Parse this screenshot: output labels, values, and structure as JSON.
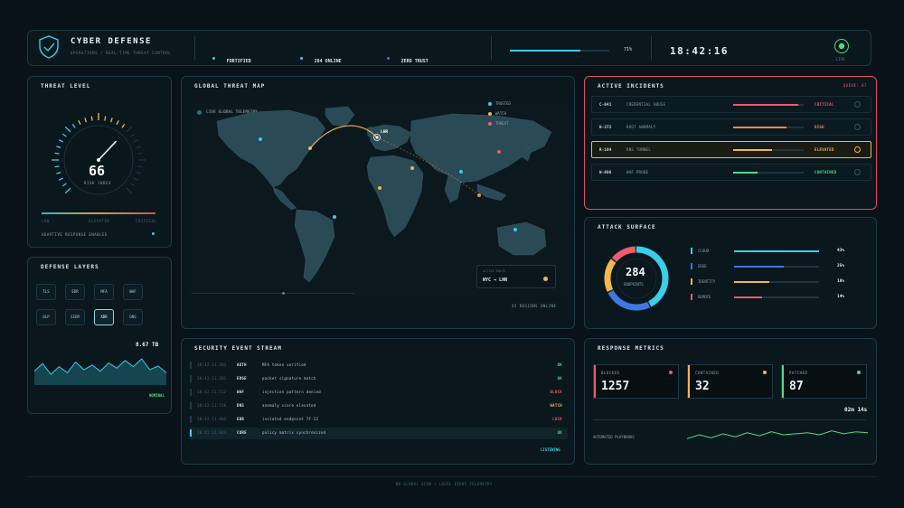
{
  "colors": {
    "bg": "#081218",
    "cyan": "#38d0e8",
    "green": "#4fdc8a",
    "red": "#ef5a6f",
    "orange": "#f08a4b",
    "yellow": "#f2b84b",
    "blue": "#3f78e0"
  },
  "header": {
    "brand_icon": "shield-check-icon",
    "title": "CYBER DEFENSE",
    "subtitle": "OPERATIONS / REAL-TIME THREAT CONTROL",
    "status_items": [
      {
        "value": "FORTIFIED",
        "dot_color": "#4fdc8a"
      },
      {
        "value": "284 ONLINE",
        "dot_color": "#38d0e8"
      },
      {
        "value": "ZERO TRUST",
        "dot_color": "#3f78e0"
      }
    ],
    "load": {
      "value_text": "71%",
      "fraction": 0.71
    },
    "clock": "18:42:16",
    "live_label": "LIVE"
  },
  "threat_level": {
    "title": "THREAT LEVEL",
    "value": "66",
    "gauge_fraction": 0.66,
    "label": "RISK INDEX",
    "scale_labels": [
      "LOW",
      "ELEVATED",
      "CRITICAL"
    ],
    "footer": "ADAPTIVE RESPONSE ENABLED"
  },
  "global_map": {
    "title": "GLOBAL THREAT MAP",
    "live_label": "LIVE GLOBAL TELEMETRY",
    "hub_label": "LHR",
    "legend": [
      {
        "label": "TRUSTED",
        "color": "#38d0e8"
      },
      {
        "label": "WATCH",
        "color": "#f2b84b"
      },
      {
        "label": "THREAT",
        "color": "#ef5a6f"
      }
    ],
    "route_box_title": "ACTIVE ROUTE",
    "route": "NYC → LHR",
    "regions_online": "42 REGIONS ONLINE"
  },
  "active_incidents": {
    "title": "ACTIVE INCIDENTS",
    "tag": "QUEUE: 07",
    "items": [
      {
        "id": "C-041",
        "name": "CREDENTIAL ABUSE",
        "status": "CRITICAL",
        "color": "#ef5a6f",
        "fill": 0.92,
        "highlight": false
      },
      {
        "id": "H-372",
        "name": "ROOT ANOMALY",
        "status": "HIGH",
        "color": "#f08a4b",
        "fill": 0.76,
        "highlight": false
      },
      {
        "id": "R-104",
        "name": "DNS TUNNEL",
        "status": "ELEVATED",
        "color": "#f2b84b",
        "fill": 0.55,
        "highlight": true
      },
      {
        "id": "W-806",
        "name": "WAF PROBE",
        "status": "CONTAINED",
        "color": "#4fdc8a",
        "fill": 0.35,
        "highlight": false
      }
    ]
  },
  "defense_layers": {
    "title": "DEFENSE LAYERS",
    "chips": [
      "TLS",
      "EDR",
      "MFA",
      "WAF",
      "DLP",
      "SIEM",
      "XDR",
      "DNS"
    ],
    "active_chip": "XDR",
    "throughput_value": "8.67 TB",
    "status": "NOMINAL",
    "sparkline": [
      0.45,
      0.7,
      0.35,
      0.6,
      0.4,
      0.75,
      0.5,
      0.65,
      0.45,
      0.72,
      0.55,
      0.8,
      0.6,
      0.85,
      0.5,
      0.62,
      0.4
    ]
  },
  "attack_surface": {
    "title": "ATTACK SURFACE",
    "total": "284",
    "total_label": "ENDPOINTS",
    "segments": [
      {
        "label": "CLOUD",
        "value": "43%",
        "fraction": 0.43,
        "color": "#38d0e8"
      },
      {
        "label": "EDGE",
        "value": "25%",
        "fraction": 0.25,
        "color": "#3f78e0"
      },
      {
        "label": "IDENTITY",
        "value": "18%",
        "fraction": 0.18,
        "color": "#f2b84b"
      },
      {
        "label": "REMOTE",
        "value": "14%",
        "fraction": 0.14,
        "color": "#ef5a6f"
      }
    ]
  },
  "event_stream": {
    "title": "SECURITY EVENT STREAM",
    "events": [
      {
        "time": "18:42:11.203",
        "source": "AUTH",
        "message": "MFA token verified",
        "status": "OK",
        "color": "#4fdc8a"
      },
      {
        "time": "18:42:11.381",
        "source": "EDGE",
        "message": "packet signature match",
        "status": "OK",
        "color": "#4fdc8a"
      },
      {
        "time": "18:42:11.512",
        "source": "WAF",
        "message": "injection pattern denied",
        "status": "BLOCK",
        "color": "#ef5a6f"
      },
      {
        "time": "18:42:11.730",
        "source": "DNS",
        "message": "anomaly score elevated",
        "status": "WATCH",
        "color": "#f2b84b"
      },
      {
        "time": "18:42:11.902",
        "source": "EDR",
        "message": "isolated endpoint 7F-22",
        "status": "LOCK",
        "color": "#ef5a6f"
      },
      {
        "time": "18:42:12.044",
        "source": "CORE",
        "message": "policy matrix synchronized",
        "status": "OK",
        "color": "#4fdc8a"
      }
    ],
    "footer_status": "LISTENING"
  },
  "response_metrics": {
    "title": "RESPONSE METRICS",
    "cards": [
      {
        "label": "BLOCKED",
        "value": "1257",
        "color": "#ef5a6f"
      },
      {
        "label": "CONTAINED",
        "value": "32",
        "color": "#f2b84b"
      },
      {
        "label": "PATCHED",
        "value": "87",
        "color": "#4fdc8a"
      }
    ],
    "response_time": "02m 14s",
    "playbooks_label": "AUTOMATED PLAYBOOKS",
    "sparkline": [
      0.3,
      0.5,
      0.35,
      0.55,
      0.4,
      0.6,
      0.45,
      0.65,
      0.5,
      0.55,
      0.6,
      0.5,
      0.7,
      0.55,
      0.65,
      0.6
    ]
  },
  "footer": {
    "center": "NO GLOBAL SCAN / LOCAL EVENT TELEMETRY"
  }
}
